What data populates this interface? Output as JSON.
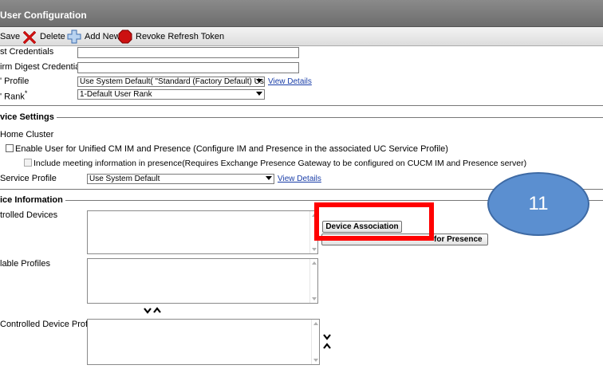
{
  "window": {
    "title": "User Configuration"
  },
  "toolbar": {
    "save_label": "Save",
    "delete_label": "Delete",
    "add_new_label": "Add New",
    "revoke_label": "Revoke Refresh Token"
  },
  "credentials": {
    "digest_label": "st Credentials",
    "confirm_digest_label": "irm Digest Credentials",
    "profile_label": "' Profile",
    "profile_value": "Use System Default( \"Standard (Factory Default) Us",
    "view_details": "View Details",
    "rank_label": "' Rank",
    "rank_required": "*",
    "rank_value": "1-Default User Rank"
  },
  "device_settings": {
    "section_title": "vice Settings",
    "home_cluster_label": "Home Cluster",
    "enable_im_label": "Enable User for Unified CM IM and Presence (Configure IM and Presence in the associated UC Service Profile)",
    "include_meeting_label": "Include meeting information in presence(Requires Exchange Presence Gateway to be configured on CUCM IM and Presence server)",
    "service_profile_label": "Service Profile",
    "service_profile_value": "Use System Default",
    "view_details": "View Details"
  },
  "device_information": {
    "section_title": "ice Information",
    "controlled_devices_label": "trolled Devices",
    "available_profiles_label": "lable Profiles",
    "controlled_profiles_label": "Controlled Device Profiles",
    "device_association_button": "Device Association",
    "presence_button_label": "for Presence"
  },
  "annotation": {
    "step_number": "11"
  },
  "colors": {
    "highlight": "#ff0000",
    "callout": "#5b8fd0",
    "link": "#1a3ea8",
    "title_bar": "#7a7a7a"
  }
}
